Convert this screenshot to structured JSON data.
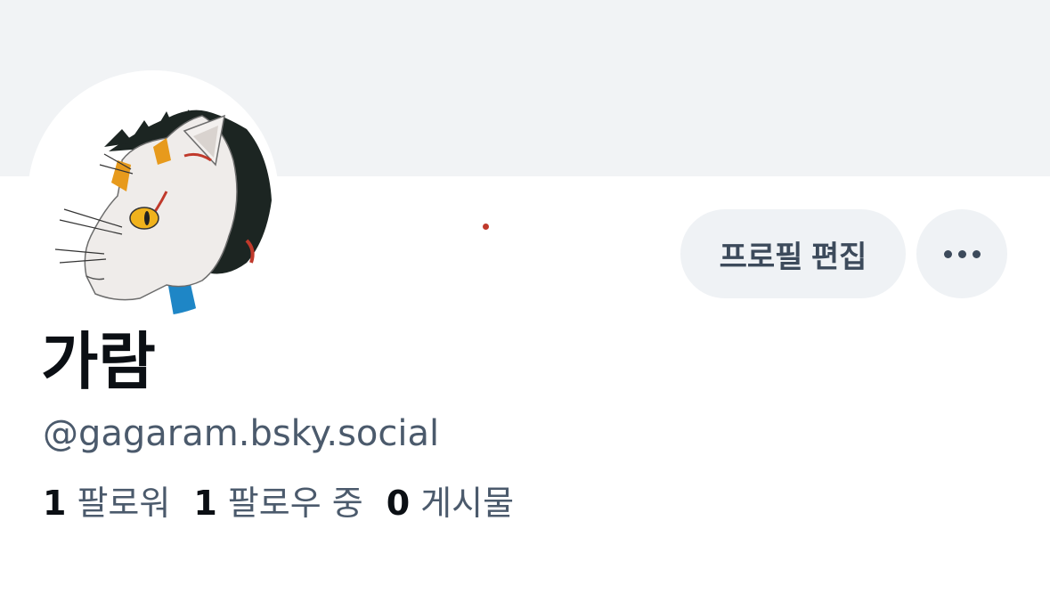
{
  "profile": {
    "display_name": "가람",
    "handle": "@gagaram.bsky.social",
    "avatar_subject": "cat-illustration-avatar"
  },
  "actions": {
    "edit_profile_label": "프로필 편집",
    "more_icon": "more-horizontal-icon"
  },
  "stats": {
    "followers": {
      "count": "1",
      "label": "팔로워"
    },
    "following": {
      "count": "1",
      "label": "팔로우 중"
    },
    "posts": {
      "count": "0",
      "label": "게시물"
    }
  },
  "colors": {
    "banner": "#f1f3f5",
    "button_bg": "#eff2f5",
    "text_primary": "#0b0f14",
    "text_secondary": "#4b5a6c"
  }
}
